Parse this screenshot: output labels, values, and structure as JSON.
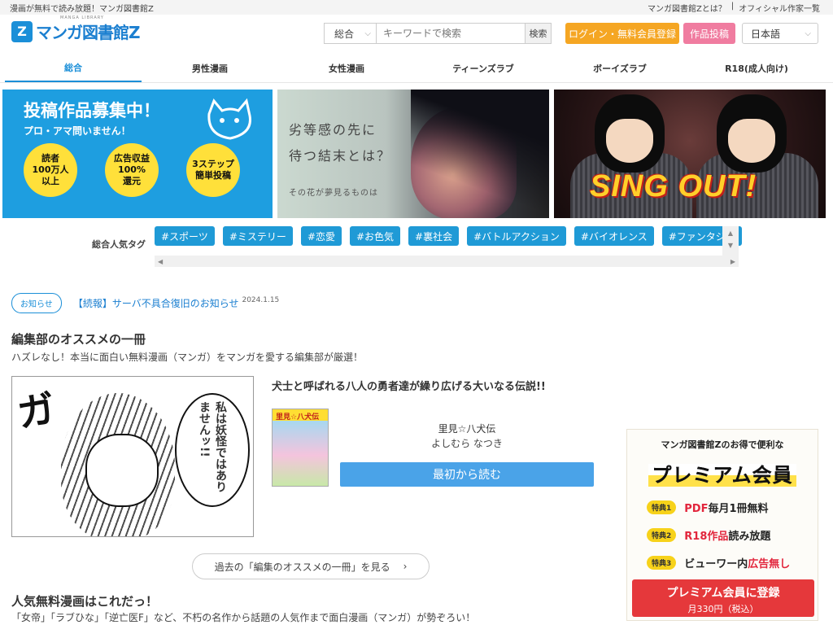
{
  "topbar": {
    "tagline": "漫画が無料で読み放題！マンガ図書館Z",
    "about_link": "マンガ図書館Zとは？",
    "separator": "|",
    "authors_link": "オフィシャル作家一覧"
  },
  "header": {
    "logo_text": "マンガ図書館Z",
    "logo_mark": "Z",
    "logo_sub": "MANGA LIBRARY",
    "search_category": "総合",
    "search_placeholder": "キーワードで検索",
    "search_button": "検索",
    "login_button": "ログイン・無料会員登録",
    "post_button": "作品投稿",
    "language": "日本語"
  },
  "nav": {
    "tabs": [
      "総合",
      "男性漫画",
      "女性漫画",
      "ティーンズラブ",
      "ボーイズラブ",
      "R18(成人向け)"
    ]
  },
  "banners": {
    "b1": {
      "title": "投稿作品募集中！",
      "subtitle": "プロ・アマ問いません！",
      "c1": "読者\n100万人\n以上",
      "c2": "広告収益\n100%\n還元",
      "c3": "3ステップ\n簡単投稿"
    },
    "b2": {
      "line1": "劣等感の先に",
      "line2": "待つ結末とは？",
      "caption": "その花が夢見るものは"
    },
    "b3": {
      "title": "SING OUT!"
    }
  },
  "tags": {
    "label": "総合人気タグ",
    "items": [
      "#スポーツ",
      "#ミステリー",
      "#恋愛",
      "#お色気",
      "#裏社会",
      "#バトルアクション",
      "#バイオレンス",
      "#ファンタジー"
    ]
  },
  "notice": {
    "badge": "お知らせ",
    "text": "【続報】サーバ不具合復旧のお知らせ",
    "date": "2024.1.15"
  },
  "editors_pick": {
    "title": "編集部のオススメの一冊",
    "subtitle": "ハズレなし！本当に面白い無料漫画（マンガ）をマンガを愛する編集部が厳選！",
    "panel_text": "私は妖怪ではありませんッ!!",
    "panel_sfx": "ガ",
    "cover_title": "里見☆八犬伝",
    "description": "犬士と呼ばれる八人の勇者達が繰り広げる大いなる伝説!!",
    "book_title": "里見☆八犬伝",
    "author": "よしむら なつき",
    "read_button": "最初から読む",
    "past_button": "過去の「編集のオススメの一冊」を見る"
  },
  "popular": {
    "title": "人気無料漫画はこれだっ！",
    "subtitle": "「女帝」「ラブひな」「逆亡医F」など、不朽の名作から話題の人気作まで面白漫画（マンガ）が勢ぞろい！"
  },
  "premium": {
    "top": "マンガ図書館Zのお得で便利な",
    "big": "プレミアム会員",
    "perks": [
      {
        "badge": "特典1",
        "red": "PDF",
        "rest": "毎月1冊無料"
      },
      {
        "badge": "特典2",
        "red": "R18作品",
        "rest": "読み放題"
      },
      {
        "badge": "特典3",
        "rest": "ビューワー内",
        "red": "広告無し"
      }
    ],
    "register": "プレミアム会員に登録",
    "price": "月330円（税込）"
  },
  "colors": {
    "accent": "#1b8fd8",
    "login": "#f5a623",
    "post": "#f07ca0",
    "register": "#e5383b"
  }
}
